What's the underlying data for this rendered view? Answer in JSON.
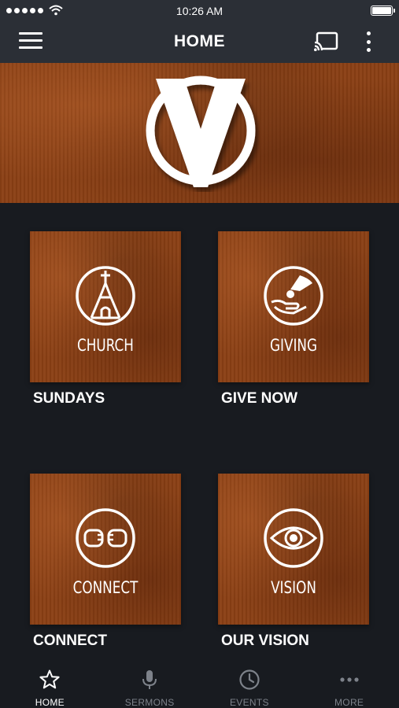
{
  "status_bar": {
    "time": "10:26 AM"
  },
  "app_bar": {
    "title": "HOME"
  },
  "tiles": [
    {
      "label": "CHURCH",
      "caption": "SUNDAYS",
      "icon": "church-icon"
    },
    {
      "label": "GIVING",
      "caption": "GIVE NOW",
      "icon": "giving-hands-icon"
    },
    {
      "label": "CONNECT",
      "caption": "CONNECT",
      "icon": "fist-bump-icon"
    },
    {
      "label": "VISION",
      "caption": "OUR VISION",
      "icon": "eye-icon"
    }
  ],
  "bottom_nav": [
    {
      "label": "HOME",
      "icon": "star-icon",
      "active": true
    },
    {
      "label": "SERMONS",
      "icon": "microphone-icon",
      "active": false
    },
    {
      "label": "EVENTS",
      "icon": "clock-icon",
      "active": false
    },
    {
      "label": "MORE",
      "icon": "more-dots-icon",
      "active": false
    }
  ],
  "colors": {
    "header": "#2b2f36",
    "background": "#181b20",
    "tile_rust": "#8a3f14",
    "nav_inactive": "#7d828a",
    "nav_active": "#ffffff"
  }
}
